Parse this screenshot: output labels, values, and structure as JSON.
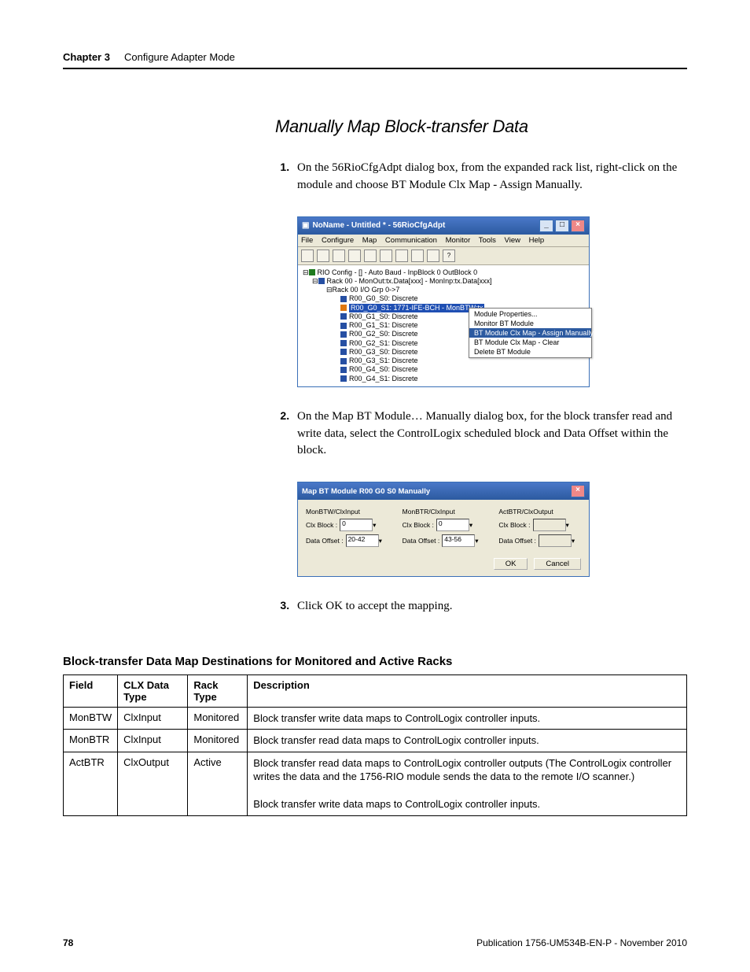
{
  "header": {
    "chapter": "Chapter 3",
    "title": "Configure Adapter Mode"
  },
  "section_heading": "Manually Map Block-transfer Data",
  "steps": [
    "On the 56RioCfgAdpt dialog box, from the expanded rack list, right-click on the module and choose BT Module Clx Map - Assign Manually.",
    "On the Map BT Module… Manually dialog box, for the block transfer read and write data, select the ControlLogix scheduled block and Data Offset within the block.",
    "Click OK to accept the mapping."
  ],
  "screenshot1": {
    "title": "NoName - Untitled * - 56RioCfgAdpt",
    "menus": [
      "File",
      "Configure",
      "Map",
      "Communication",
      "Monitor",
      "Tools",
      "View",
      "Help"
    ],
    "tree": {
      "root": "RIO Config - [] - Auto Baud - InpBlock 0 OutBlock 0",
      "rack": "Rack 00 - MonOut:tx.Data[xxx] - MonInp:tx.Data[xxx]",
      "iogroup": "Rack 00 I/O Grp 0->7",
      "selected": "R00_G0_S1: 1771-IFE-BCH - MonBTW:tx",
      "items": [
        "R00_G0_S0: Discrete",
        "R00_G1_S0: Discrete",
        "R00_G1_S1: Discrete",
        "R00_G2_S0: Discrete",
        "R00_G2_S1: Discrete",
        "R00_G3_S0: Discrete",
        "R00_G3_S1: Discrete",
        "R00_G4_S0: Discrete",
        "R00_G4_S1: Discrete"
      ]
    },
    "context_menu": {
      "items": [
        "Module Properties...",
        "Monitor BT Module",
        "BT Module Clx Map - Assign Manually ...",
        "BT Module Clx Map - Clear",
        "Delete BT Module"
      ],
      "selected_index": 2
    }
  },
  "screenshot2": {
    "title": "Map BT Module R00 G0 S0 Manually",
    "cols": [
      {
        "heading": "MonBTW/ClxInput",
        "clx_block": "0",
        "data_offset": "20-42",
        "enabled": true
      },
      {
        "heading": "MonBTR/ClxInput",
        "clx_block": "0",
        "data_offset": "43-56",
        "enabled": true
      },
      {
        "heading": "ActBTR/ClxOutput",
        "clx_block": "",
        "data_offset": "",
        "enabled": false
      }
    ],
    "buttons": {
      "ok": "OK",
      "cancel": "Cancel"
    }
  },
  "table_heading": "Block-transfer Data Map Destinations for Monitored and Active Racks",
  "table": {
    "headers": [
      "Field",
      "CLX Data Type",
      "Rack Type",
      "Description"
    ],
    "rows": [
      {
        "field": "MonBTW",
        "clx": "ClxInput",
        "rack": "Monitored",
        "desc": "Block transfer write data maps to ControlLogix controller inputs."
      },
      {
        "field": "MonBTR",
        "clx": "ClxInput",
        "rack": "Monitored",
        "desc": "Block transfer read data maps to ControlLogix controller inputs."
      },
      {
        "field": "ActBTR",
        "clx": "ClxOutput",
        "rack": "Active",
        "desc": "Block transfer read data maps to ControlLogix controller outputs (The ControlLogix controller writes the data and the 1756-RIO module sends the data to the remote I/O scanner.)\n\nBlock transfer write data maps to ControlLogix controller inputs."
      }
    ]
  },
  "footer": {
    "page": "78",
    "publication": "Publication 1756-UM534B-EN-P - November 2010"
  }
}
